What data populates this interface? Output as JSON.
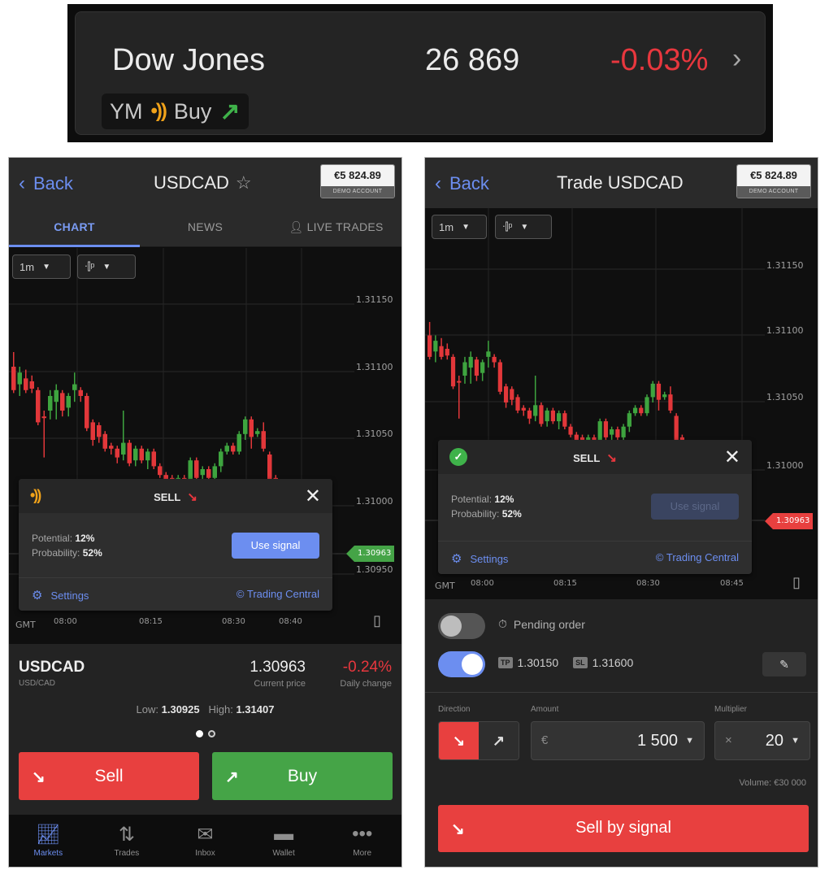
{
  "ticker": {
    "name": "Dow Jones",
    "price": "26 869",
    "change": "-0.03%",
    "chevron": "›",
    "badge": {
      "symbol": "YM",
      "signal_icon": "signal-icon",
      "signal": "Buy",
      "arrow": "↗"
    }
  },
  "left": {
    "header": {
      "back": "Back",
      "title": "USDCAD",
      "favorite_icon": "☆",
      "balance": "€5 824.89",
      "account_type": "DEMO ACCOUNT"
    },
    "tabs": [
      {
        "label": "CHART",
        "active": true
      },
      {
        "label": "NEWS",
        "active": false
      },
      {
        "label": "LIVE TRADES",
        "icon": "person-icon",
        "active": false
      }
    ],
    "chart": {
      "timeframe": "1m",
      "chart_type_icon": "candles-icon",
      "y_labels": [
        "1.31150",
        "1.31100",
        "1.31050",
        "1.31000",
        "1.30950"
      ],
      "x_labels": [
        "GMT",
        "08:00",
        "08:15",
        "08:30",
        "08:40"
      ],
      "current_price_tag": "1.30963"
    },
    "signal": {
      "title": "SELL",
      "arrow": "↘",
      "potential_label": "Potential:",
      "potential": "12%",
      "probability_label": "Probability:",
      "probability": "52%",
      "use_signal": "Use signal",
      "settings": "Settings",
      "provider": "© Trading Central"
    },
    "info": {
      "symbol": "USDCAD",
      "symbol_sub": "USD/CAD",
      "current_price": "1.30963",
      "current_price_label": "Current price",
      "daily_change": "-0.24%",
      "daily_change_label": "Daily change",
      "low_label": "Low:",
      "low": "1.30925",
      "high_label": "High:",
      "high": "1.31407",
      "page_index": 1,
      "page_count": 2
    },
    "actions": {
      "sell": "Sell",
      "buy": "Buy",
      "sell_icon": "↘",
      "buy_icon": "↗"
    },
    "nav": [
      {
        "label": "Markets",
        "icon": "markets-icon",
        "active": true
      },
      {
        "label": "Trades",
        "icon": "trades-icon",
        "active": false
      },
      {
        "label": "Inbox",
        "icon": "inbox-icon",
        "active": false
      },
      {
        "label": "Wallet",
        "icon": "wallet-icon",
        "active": false
      },
      {
        "label": "More",
        "icon": "more-icon",
        "active": false
      }
    ]
  },
  "right": {
    "header": {
      "back": "Back",
      "title": "Trade USDCAD",
      "balance": "€5 824.89",
      "account_type": "DEMO ACCOUNT"
    },
    "chart": {
      "timeframe": "1m",
      "chart_type_icon": "candles-icon",
      "y_labels": [
        "1.31150",
        "1.31100",
        "1.31050",
        "1.31000"
      ],
      "x_labels": [
        "GMT",
        "08:00",
        "08:15",
        "08:30",
        "08:45"
      ],
      "current_price_tag": "1.30963"
    },
    "signal": {
      "title": "SELL",
      "arrow": "↘",
      "potential_label": "Potential:",
      "potential": "12%",
      "probability_label": "Probability:",
      "probability": "52%",
      "use_signal": "Use signal",
      "settings": "Settings",
      "provider": "© Trading Central"
    },
    "form": {
      "pending_order_label": "Pending order",
      "pending_order_on": false,
      "tpsl_on": true,
      "tp_tag": "TP",
      "tp_value": "1.30150",
      "sl_tag": "SL",
      "sl_value": "1.31600",
      "direction_label": "Direction",
      "direction": "sell",
      "amount_label": "Amount",
      "amount_currency": "€",
      "amount": "1 500",
      "multiplier_label": "Multiplier",
      "multiplier_prefix": "×",
      "multiplier": "20",
      "volume": "Volume: €30 000",
      "submit": "Sell by signal",
      "submit_icon": "↘"
    }
  },
  "colors": {
    "accent": "#6c8ef0",
    "sell": "#e8403f",
    "buy": "#45a447",
    "negative": "#e8373e",
    "signal": "#f0a21a"
  }
}
